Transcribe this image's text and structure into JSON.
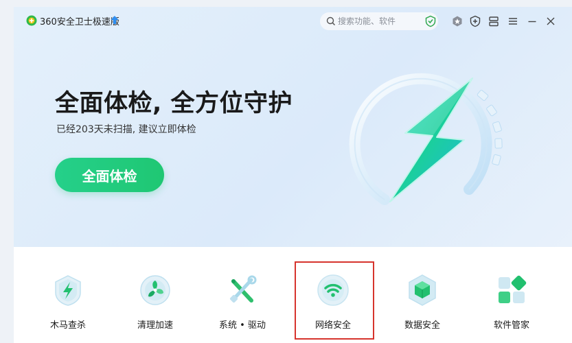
{
  "window": {
    "title": "360安全卫士极速版",
    "search_placeholder": "搜索功能、软件"
  },
  "titlebar_icons": [
    "shield-check-icon",
    "hexagon-badge-icon",
    "plus-shield-icon",
    "layout-icon",
    "menu-icon",
    "minimize-icon",
    "close-icon"
  ],
  "hero": {
    "headline": "全面体检, 全方位守护",
    "subtitle": "已经203天未扫描, 建议立即体检",
    "cta_label": "全面体检"
  },
  "tools": [
    {
      "label": "木马查杀",
      "icon": "trojan-scan-icon"
    },
    {
      "label": "清理加速",
      "icon": "cleanup-fan-icon"
    },
    {
      "label": "系统 • 驱动",
      "icon": "system-driver-tools-icon"
    },
    {
      "label": "网络安全",
      "icon": "wifi-security-icon",
      "selected": true
    },
    {
      "label": "数据安全",
      "icon": "data-cube-icon"
    },
    {
      "label": "软件管家",
      "icon": "software-manager-icon"
    }
  ],
  "colors": {
    "accent_green": "#22cc7e",
    "selection_border": "#d6332c",
    "hero_bg": "#dbeafa"
  }
}
